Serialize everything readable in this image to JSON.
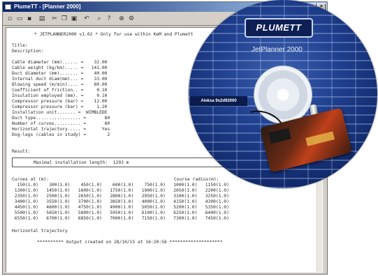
{
  "window": {
    "title": "PlumeTT - [Planner 2000]",
    "controls": [
      "_",
      "□",
      "×"
    ]
  },
  "toolbar": {
    "icons": [
      "new-icon",
      "open-icon",
      "save-icon",
      "print-icon",
      "cut-icon",
      "copy-icon",
      "paste-icon",
      "undo-icon",
      "find-icon",
      "help-icon",
      "zoom-icon",
      "settings-icon"
    ]
  },
  "document": {
    "header": "* JETPLANNER2000 v1.02 * Only for use within KeM and Plumett",
    "title_label": "Title:",
    "description_label": "Description:",
    "params": [
      "Cable diameter (mm)...... =    32.00",
      "Cable weight (kg/km)..... =   141.00",
      "Duct diameter (mm)....... =    40.00",
      "Internal duct diam(mm)... =    33.00",
      "Blowing speed (m/min).... =    80.00",
      "Coefficient of friction.. =     0.10",
      "Insulation employed (mm). =     0.10",
      "Compressor pressure (bar) =    12.00",
      "Compressor pressure (bar) =     1.20",
      "Installation unit....... =  WIMBLEDE",
      "Duct type................. =       80",
      "Number of curves.......... =       80",
      "Horizontal trajectory..... =      Yes",
      "Dog-legs (cables in study) =        2"
    ],
    "result_label": "Result:",
    "result_line": "Maximal installation length:  1293 m",
    "curves_label": "Curves at (m):",
    "curves_radius_label": "Course radius(m):",
    "curves_rows": [
      "  150(1.0)    300(1.0)    450(1.0)    600(1.0)    750(1.0)   1000(1.0)   1150(1.0)",
      " 1300(1.0)   1450(1.0)   1600(1.0)   1750(1.0)   1900(1.0)   2050(1.0)   2200(1.0)",
      " 2350(1.0)   2500(1.0)   2650(1.0)   2800(1.0)   2950(1.0)   3100(1.0)   3250(1.0)",
      " 3400(1.0)   3550(1.0)   3700(1.0)   3850(1.0)   4000(1.0)   4150(1.0)   4300(1.0)",
      " 4450(1.0)   4600(1.0)   4750(1.0)   4900(1.0)   5050(1.0)   5200(1.0)   5350(1.0)",
      " 5500(1.0)   5650(1.0)   5800(1.0)   5950(1.0)   6100(1.0)   6250(1.0)   6400(1.0)",
      " 6550(1.0)   6700(1.0)   6850(1.0)   7000(1.0)   7150(1.0)   7300(1.0)   7450(1.0)"
    ],
    "trajectory_label": "Horizontal trajectory",
    "footer": "********** Output created on 28/10/15 at 16:20:56 ********************"
  },
  "cd": {
    "brand": "PLUMETT",
    "product": "JetPlanner 2000",
    "badge": "Aleksa 9s2d92000"
  }
}
